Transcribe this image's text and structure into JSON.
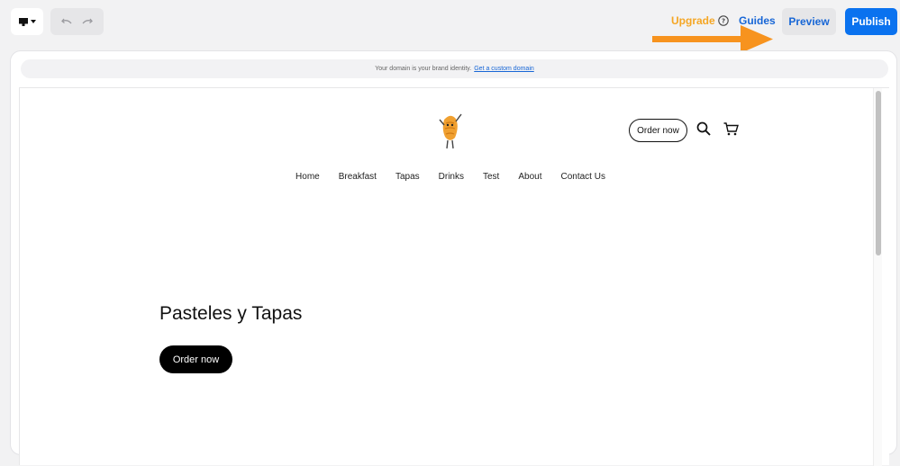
{
  "toolbar": {
    "upgrade_label": "Upgrade",
    "guides_label": "Guides",
    "preview_label": "Preview",
    "publish_label": "Publish",
    "accent_color": "#f5a623",
    "link_color": "#1766d6",
    "publish_color": "#0a72ef"
  },
  "domain_banner": {
    "text": "Your domain is your brand identity.",
    "link": "Get a custom domain"
  },
  "site": {
    "header_button": "Order now",
    "nav": [
      "Home",
      "Breakfast",
      "Tapas",
      "Drinks",
      "Test",
      "About",
      "Contact Us"
    ],
    "hero_title": "Pasteles y Tapas",
    "hero_button": "Order now"
  },
  "icons": [
    "desktop-icon",
    "caret-down-icon",
    "undo-icon",
    "redo-icon",
    "help-icon",
    "arrow-icon",
    "croissant-logo",
    "search-icon",
    "cart-icon"
  ]
}
